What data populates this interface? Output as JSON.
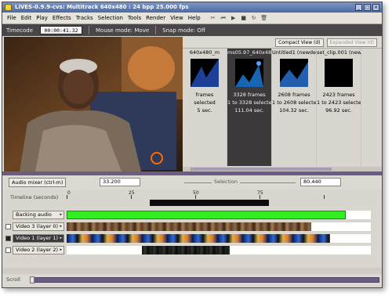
{
  "window": {
    "title": "LiVES-0.9.9-cvs: Multitrack 640x480 : 24 bpp 25.000 fps"
  },
  "menu": [
    "File",
    "Edit",
    "Play",
    "Effects",
    "Tracks",
    "Selection",
    "Tools",
    "Render",
    "View",
    "Help"
  ],
  "timebar": {
    "label": "Timecode",
    "timecode": "00:00:41.32",
    "mouse_mode": "Mouse mode: Move",
    "snap_mode": "Snap mode: Off"
  },
  "clip_panel": {
    "compact_view": "Compact View (d)",
    "expanded_view": "Expanded View (d)",
    "clips": [
      {
        "name": "640x480_m",
        "frames": "frames",
        "selected": "selected",
        "length": "5 sec.",
        "active": false,
        "color": "#2a5ad8"
      },
      {
        "name": "ms05.97_640x480_ms",
        "frames": "3328 frames",
        "selected": "1 to 3328 selected",
        "length": "111.04 sec.",
        "active": true,
        "color": "#1e7ee0"
      },
      {
        "name": "Untitled1 (newdem",
        "frames": "2608 frames",
        "selected": "1 to 2608 selected",
        "length": "104.32 sec.",
        "active": false,
        "color": "#2f7de8"
      },
      {
        "name": "set_clip.001 (new",
        "frames": "2423 frames",
        "selected": "1 to 2423 selected",
        "length": "96.92 sec.",
        "active": false,
        "color": "#000000"
      }
    ]
  },
  "controls": {
    "audio_mixer": "Audio mixer (ctrl-m)",
    "start": "33.200",
    "selection_label": "Selection",
    "end": "80.440"
  },
  "timeline": {
    "label": "Timeline (seconds)",
    "ticks": [
      "0",
      "25",
      "50",
      "75"
    ]
  },
  "tracks": [
    {
      "name": "Backing audio",
      "type": "audio",
      "checkbox": false,
      "highlighted": false
    },
    {
      "name": "Video 3 (layer 0)",
      "type": "video",
      "checkbox": true,
      "highlighted": false
    },
    {
      "name": "Video 1 (layer 1)",
      "type": "video",
      "checkbox": true,
      "highlighted": true
    },
    {
      "name": "Video 2 (layer 2)",
      "type": "video",
      "checkbox": true,
      "highlighted": false
    }
  ],
  "scroll": {
    "label": "Scroll"
  },
  "colors": {
    "accent": "#6a5b87",
    "audio_bar": "#33ee22",
    "title_bar": "#5a78b0"
  }
}
